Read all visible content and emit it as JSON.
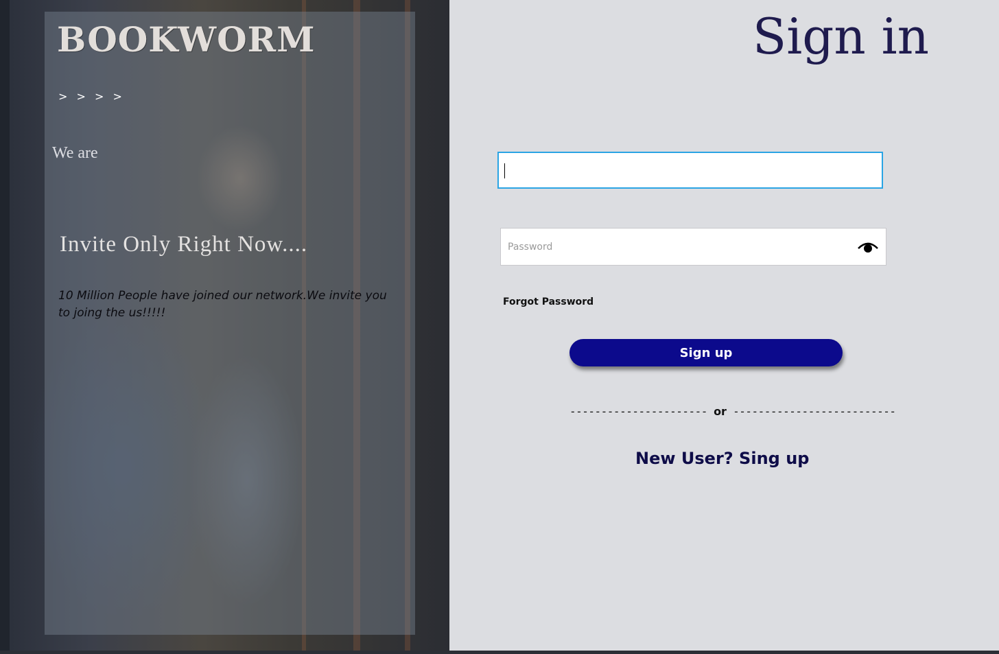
{
  "brand": {
    "logo_text": "BOOKWORM",
    "arrows": "> > > >"
  },
  "hero": {
    "we_are": "We are",
    "heading": "Invite Only Right Now....",
    "body": "10 Million People have joined our network.We invite you to joing the us!!!!!"
  },
  "form": {
    "title": "Sign in",
    "email_value": "",
    "password_placeholder": "Password",
    "password_toggle_icon": "eye-icon",
    "forgot_password_label": "Forgot Password",
    "submit_label": "Sign up",
    "divider_dashes_left": "----------------------",
    "divider_or": "or",
    "divider_dashes_right": "--------------------------",
    "new_user_label": "New User? Sing up"
  },
  "colors": {
    "title": "#1f1b4e",
    "button_bg": "#0c0a8c",
    "focus_border": "#2aa4e4",
    "panel_bg": "#dcdde1"
  }
}
